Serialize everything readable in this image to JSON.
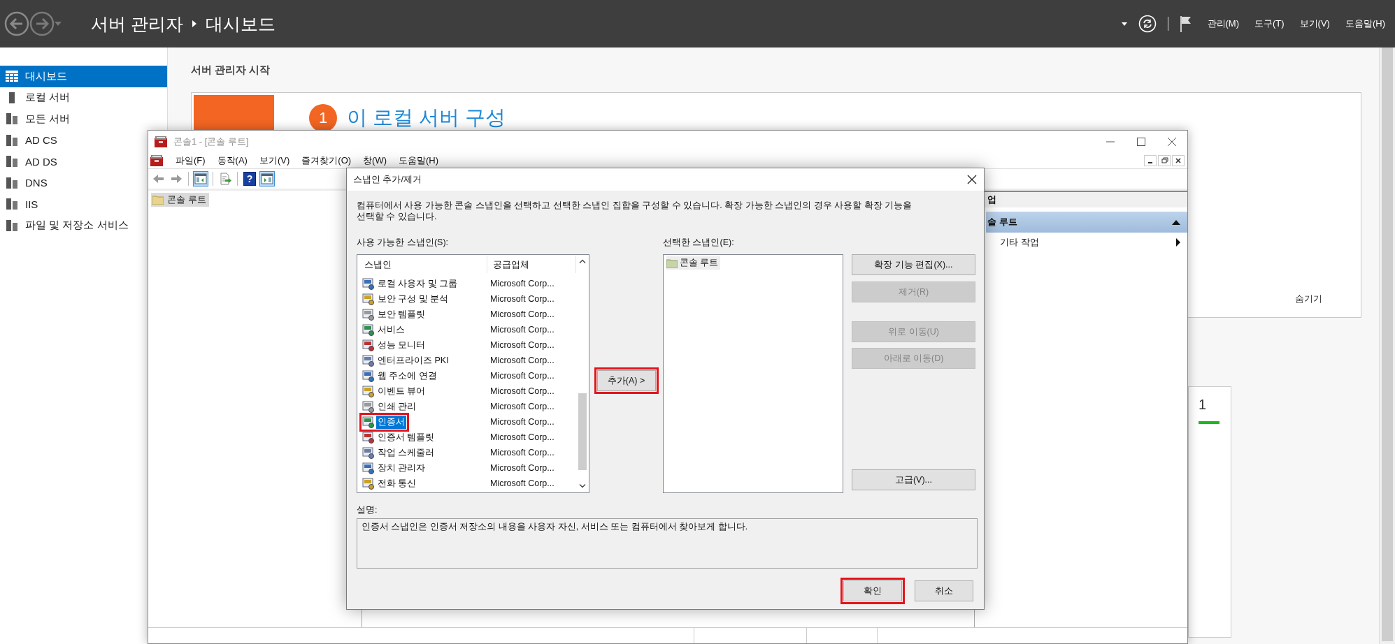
{
  "top_bar": {
    "title": "서버 관리자",
    "crumb": "대시보드",
    "menus": [
      "관리(M)",
      "도구(T)",
      "보기(V)",
      "도움말(H)"
    ]
  },
  "sidebar": {
    "items": [
      {
        "label": "대시보드",
        "selected": true
      },
      {
        "label": "로컬 서버",
        "selected": false
      },
      {
        "label": "모든 서버",
        "selected": false
      },
      {
        "label": "AD CS",
        "selected": false
      },
      {
        "label": "AD DS",
        "selected": false
      },
      {
        "label": "DNS",
        "selected": false
      },
      {
        "label": "IIS",
        "selected": false
      },
      {
        "label": "파일 및 저장소 서비스",
        "selected": false
      }
    ]
  },
  "main": {
    "heading": "서버 관리자 시작",
    "step_number": "1",
    "step_title": "이 로컬 서버 구성",
    "hide_link": "숨기기",
    "tile_count": "1"
  },
  "mmc": {
    "title": "콘솔1 - [콘솔 루트]",
    "menus": [
      "파일(F)",
      "동작(A)",
      "보기(V)",
      "즐겨찾기(O)",
      "창(W)",
      "도움말(H)"
    ],
    "toolbar": [
      {
        "kind": "back",
        "pressed": false
      },
      {
        "kind": "forward",
        "pressed": false
      },
      {
        "kind": "separator"
      },
      {
        "kind": "tree",
        "pressed": true
      },
      {
        "kind": "separator"
      },
      {
        "kind": "export",
        "pressed": false
      },
      {
        "kind": "separator"
      },
      {
        "kind": "help",
        "pressed": false,
        "label": "?"
      },
      {
        "kind": "action_pane",
        "pressed": true
      }
    ],
    "tree": [
      {
        "label": "콘솔 루트",
        "selected": true
      }
    ],
    "actions": {
      "header": "업",
      "section": "솔 루트",
      "items": [
        "기타 작업"
      ]
    }
  },
  "dialog": {
    "title": "스냅인 추가/제거",
    "intro": "컴퓨터에서 사용 가능한 콘솔 스냅인을 선택하고 선택한 스냅인 집합을 구성할 수 있습니다. 확장 가능한 스냅인의 경우 사용할 확장 기능을 선택할 수 있습니다.",
    "available_label": "사용 가능한 스냅인(S):",
    "columns": [
      "스냅인",
      "공급업체"
    ],
    "rows": [
      {
        "name": "로컬 사용자 및 그룹",
        "vendor": "Microsoft Corp...",
        "selected": false,
        "highlighted": false
      },
      {
        "name": "보안 구성 및 분석",
        "vendor": "Microsoft Corp...",
        "selected": false,
        "highlighted": false
      },
      {
        "name": "보안 템플릿",
        "vendor": "Microsoft Corp...",
        "selected": false,
        "highlighted": false
      },
      {
        "name": "서비스",
        "vendor": "Microsoft Corp...",
        "selected": false,
        "highlighted": false
      },
      {
        "name": "성능 모니터",
        "vendor": "Microsoft Corp...",
        "selected": false,
        "highlighted": false
      },
      {
        "name": "엔터프라이즈 PKI",
        "vendor": "Microsoft Corp...",
        "selected": false,
        "highlighted": false
      },
      {
        "name": "웹 주소에 연결",
        "vendor": "Microsoft Corp...",
        "selected": false,
        "highlighted": false
      },
      {
        "name": "이벤트 뷰어",
        "vendor": "Microsoft Corp...",
        "selected": false,
        "highlighted": false
      },
      {
        "name": "인쇄 관리",
        "vendor": "Microsoft Corp...",
        "selected": false,
        "highlighted": false
      },
      {
        "name": "인증서",
        "vendor": "Microsoft Corp...",
        "selected": true,
        "highlighted": true
      },
      {
        "name": "인증서 템플릿",
        "vendor": "Microsoft Corp...",
        "selected": false,
        "highlighted": false
      },
      {
        "name": "작업 스케줄러",
        "vendor": "Microsoft Corp...",
        "selected": false,
        "highlighted": false
      },
      {
        "name": "장치 관리자",
        "vendor": "Microsoft Corp...",
        "selected": false,
        "highlighted": false
      },
      {
        "name": "전화 통신",
        "vendor": "Microsoft Corp...",
        "selected": false,
        "highlighted": false
      }
    ],
    "add_button": {
      "label": "추가(A) >",
      "highlighted": true
    },
    "selected_label": "선택한 스냅인(E):",
    "selected_items": [
      "콘솔 루트"
    ],
    "side_buttons": [
      {
        "label": "확장 기능 편집(X)...",
        "disabled": false
      },
      {
        "label": "제거(R)",
        "disabled": true
      },
      {
        "label": "위로 이동(U)",
        "disabled": true
      },
      {
        "label": "아래로 이동(D)",
        "disabled": true
      },
      {
        "label": "고급(V)...",
        "disabled": false
      }
    ],
    "description_label": "설명:",
    "description": "인증서 스냅인은 인증서 저장소의 내용을 사용자 자신, 서비스 또는 컴퓨터에서 찾아보게 합니다.",
    "buttons": [
      {
        "label": "확인",
        "highlighted": true
      },
      {
        "label": "취소",
        "highlighted": false
      }
    ]
  }
}
